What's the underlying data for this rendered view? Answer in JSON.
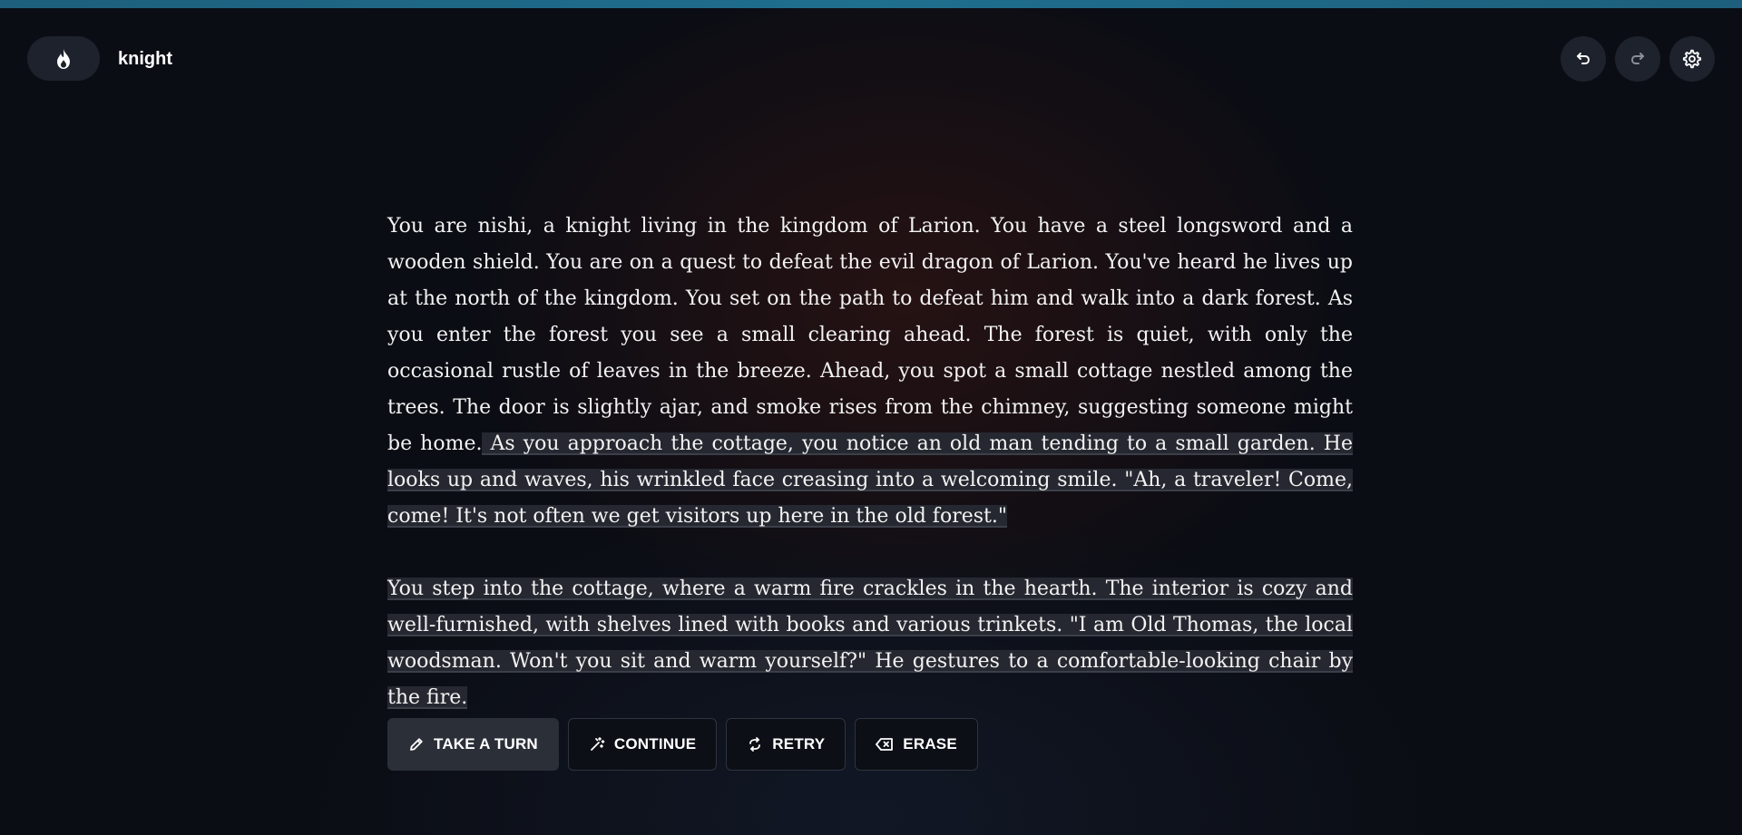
{
  "header": {
    "logo_icon": "flame-icon",
    "title": "knight",
    "toolbar": [
      {
        "name": "undo-button",
        "icon": "undo-icon"
      },
      {
        "name": "redo-button",
        "icon": "redo-icon"
      },
      {
        "name": "settings-button",
        "icon": "gear-icon"
      }
    ]
  },
  "story": {
    "intro": "You are nishi, a knight living in the kingdom of Larion. You have a steel longsword and a wooden shield. You are on a quest to defeat the evil dragon of Larion. You've heard he lives up at the north of the kingdom. You set on the path to defeat him and walk into a dark forest. As you enter the forest you see a small clearing ahead. The forest is quiet, with only the occasional rustle of leaves in the breeze. Ahead, you spot a small cottage nestled among the trees. The door is slightly ajar, and smoke rises from the chimney, suggesting someone might be home.",
    "continuation_1": " As you approach the cottage, you notice an old man tending to a small garden. He looks up and waves, his wrinkled face creasing into a welcoming smile. \"Ah, a traveler! Come, come! It's not often we get visitors up here in the old forest.\"",
    "continuation_2": "You step into the cottage, where a warm fire crackles in the hearth. The interior is cozy and well-furnished, with shelves lined with books and various trinkets. \"I am Old Thomas, the local woodsman. Won't you sit and warm yourself?\" He gestures to a comfortable-looking chair by the fire."
  },
  "actions": {
    "take_turn": {
      "label": "TAKE A TURN",
      "icon": "pencil-icon"
    },
    "continue": {
      "label": "CONTINUE",
      "icon": "magic-wand-icon"
    },
    "retry": {
      "label": "RETRY",
      "icon": "retry-icon"
    },
    "erase": {
      "label": "ERASE",
      "icon": "backspace-icon"
    }
  },
  "colors": {
    "accent_bar": "#1f6f8e",
    "background": "#0b0d14",
    "highlight": "#252830",
    "button_primary": "#2b2f38"
  }
}
